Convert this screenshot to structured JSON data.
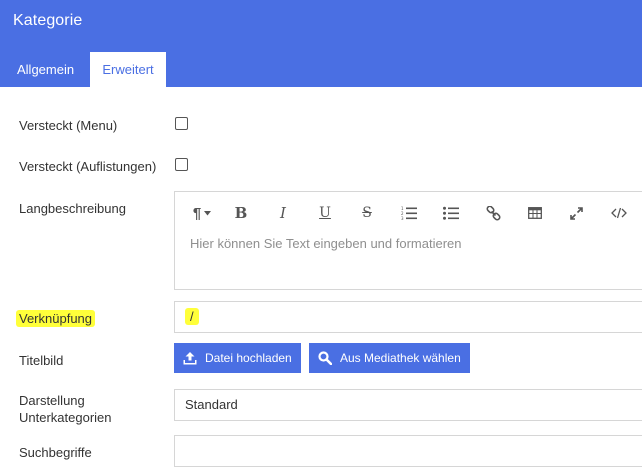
{
  "header": {
    "title": "Kategorie"
  },
  "tabs": [
    {
      "label": "Allgemein"
    },
    {
      "label": "Erweitert"
    }
  ],
  "fields": {
    "hidden_menu": {
      "label": "Versteckt (Menu)",
      "checked": false
    },
    "hidden_listings": {
      "label": "Versteckt (Auflistungen)",
      "checked": false
    },
    "long_description": {
      "label": "Langbeschreibung",
      "placeholder": "Hier können Sie Text eingeben und formatieren"
    },
    "link": {
      "label": "Verknüpfung",
      "value": "/"
    },
    "title_image": {
      "label": "Titelbild",
      "upload_label": "Datei hochladen",
      "media_label": "Aus Mediathek wählen"
    },
    "sub_display": {
      "label_line1": "Darstellung",
      "label_line2": "Unterkategorien",
      "value": "Standard"
    },
    "keywords": {
      "label": "Suchbegriffe",
      "value": ""
    }
  },
  "toolbar_icons": [
    "paragraph-icon",
    "bold-icon",
    "italic-icon",
    "underline-icon",
    "strikethrough-icon",
    "ordered-list-icon",
    "unordered-list-icon",
    "link-icon",
    "table-icon",
    "fullscreen-icon",
    "code-view-icon"
  ],
  "colors": {
    "accent": "#4a6fe3",
    "highlight": "#ffff3a"
  }
}
